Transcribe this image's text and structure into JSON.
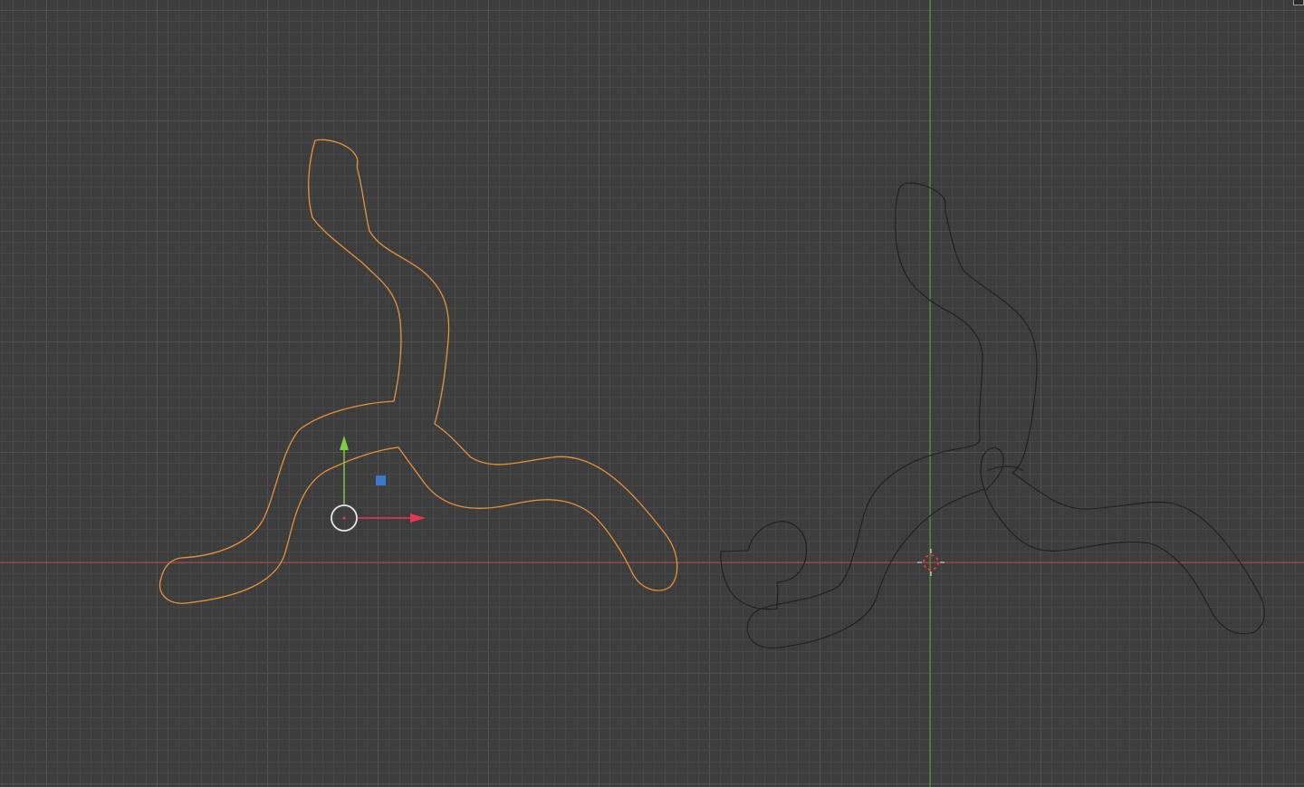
{
  "viewport": {
    "background_color": "#3d3d3d",
    "grid_minor_color": "#474747",
    "grid_major_color": "#525252",
    "x_axis_color": "#b3444a",
    "y_axis_color": "#6a9a2e"
  },
  "objects": {
    "selected_curve": {
      "name": "selected-curve-outline",
      "outline_color": "#e8913a",
      "selected": true
    },
    "unselected_curve": {
      "name": "unselected-curve-outline",
      "outline_color": "#1e1e1e",
      "selected": false
    }
  },
  "gizmo": {
    "x_arrow_color": "#e8364f",
    "y_arrow_color": "#7dd040",
    "free_move_handle_color": "#3a78c9",
    "origin_ring_color": "#e6e6e6",
    "origin_dot_color": "#e8364f"
  },
  "cursor_3d": {
    "icon": "3d-cursor-icon",
    "ring_colors": [
      "#e8e8e8",
      "#e84040"
    ]
  },
  "corner_widget": {
    "icon": "area-corner-icon"
  }
}
